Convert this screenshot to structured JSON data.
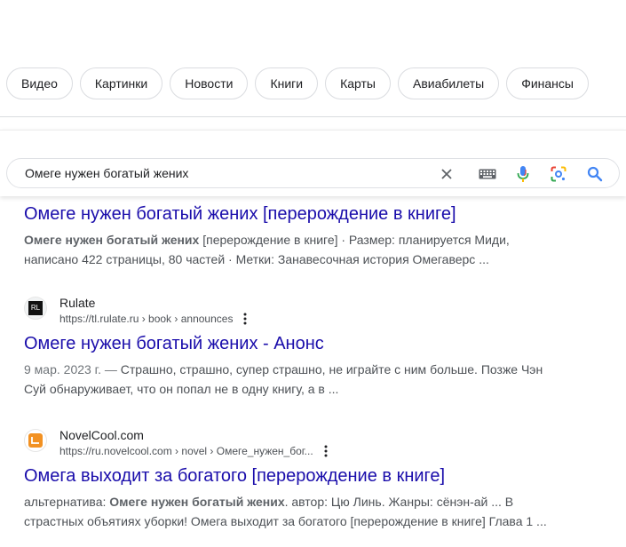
{
  "chips": [
    "Видео",
    "Картинки",
    "Новости",
    "Книги",
    "Карты",
    "Авиабилеты",
    "Финансы"
  ],
  "search": {
    "query": "Омеге нужен богатый жених",
    "icons": [
      "close-icon",
      "keyboard-icon",
      "microphone-icon",
      "lens-icon",
      "search-icon"
    ]
  },
  "results": [
    {
      "title": "Омеге нужен богатый жених [перерождение в книге]",
      "snippet_bold": "Омеге нужен богатый жених",
      "snippet_rest": " [перерождение в книге] · Размер: планируется Миди, написано 422 страницы, 80 частей · Метки: Занавесочная история Омегаверс ..."
    },
    {
      "site_name": "Rulate",
      "favicon_text": "RL",
      "url": "https://tl.rulate.ru › book › announces",
      "title": "Омеге нужен богатый жених - Анонс",
      "snippet_date": "9 мар. 2023 г. — ",
      "snippet_rest": "Страшно, страшно, супер страшно, не играйте с ним больше. Позже Чэн Суй обнаруживает, что он попал не в одну книгу, а в ..."
    },
    {
      "site_name": "NovelCool.com",
      "url": "https://ru.novelcool.com › novel › Омеге_нужен_бог...",
      "title": "Омега выходит за богатого [перерождение в книге]",
      "snippet_pre": "альтернатива: ",
      "snippet_bold": "Омеге нужен богатый жених",
      "snippet_rest": ". автор: Цю Линь. Жанры: сёнэн-ай ... В страстных объятиях уборки! Омега выходит за богатого [перерождение в книге] Глава 1 ..."
    }
  ],
  "colors": {
    "link": "#1a0dab",
    "snippet": "#4d5156",
    "novelcool_brand": "#f29122"
  }
}
